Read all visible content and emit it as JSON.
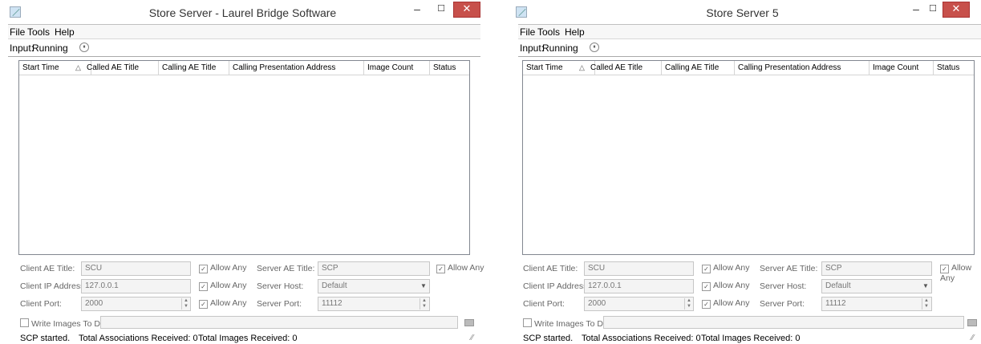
{
  "windows": [
    {
      "title": "Store Server - Laurel Bridge Software",
      "controls": {
        "minimize": "–",
        "maximize": "☐",
        "close": "✕"
      },
      "menu": [
        "File",
        "Tools",
        "Help"
      ],
      "input": {
        "label": "Input:",
        "state": "Running",
        "pause_glyph": "⏸"
      },
      "table": {
        "columns": [
          "Start Time",
          "Called AE Title",
          "Calling AE Title",
          "Calling Presentation Address",
          "Image Count",
          "Status"
        ],
        "sort_indicator": "△",
        "rows": []
      },
      "form": {
        "client_ae_label": "Client AE Title:",
        "client_ae_value": "SCU",
        "client_ip_label": "Client IP Address:",
        "client_ip_value": "127.0.0.1",
        "client_port_label": "Client Port:",
        "client_port_value": "2000",
        "allow_any": "Allow Any",
        "server_ae_label": "Server AE Title:",
        "server_ae_value": "SCP",
        "server_host_label": "Server Host:",
        "server_host_value": "Default",
        "server_port_label": "Server Port:",
        "server_port_value": "11112",
        "write_images_label": "Write Images To Disk"
      },
      "status": {
        "message": "SCP started.",
        "associations": "Total Associations Received: 0",
        "images": "Total Images Received: 0"
      }
    },
    {
      "title": "Store Server 5",
      "controls": {
        "minimize": "–",
        "maximize": "☐",
        "close": "✕"
      },
      "menu": [
        "File",
        "Tools",
        "Help"
      ],
      "input": {
        "label": "Input:",
        "state": "Running",
        "pause_glyph": "⏸"
      },
      "table": {
        "columns": [
          "Start Time",
          "Called AE Title",
          "Calling AE Title",
          "Calling Presentation Address",
          "Image Count",
          "Status"
        ],
        "sort_indicator": "△",
        "rows": []
      },
      "form": {
        "client_ae_label": "Client AE Title:",
        "client_ae_value": "SCU",
        "client_ip_label": "Client IP Address:",
        "client_ip_value": "127.0.0.1",
        "client_port_label": "Client Port:",
        "client_port_value": "2000",
        "allow_any": "Allow Any",
        "server_ae_label": "Server AE Title:",
        "server_ae_value": "SCP",
        "server_host_label": "Server Host:",
        "server_host_value": "Default",
        "server_port_label": "Server Port:",
        "server_port_value": "11112",
        "write_images_label": "Write Images To Disk"
      },
      "status": {
        "message": "SCP started.",
        "associations": "Total Associations Received: 0",
        "images": "Total Images Received: 0"
      }
    }
  ],
  "colors": {
    "close_button": "#c7504b",
    "table_border": "#828790",
    "field_bg": "#f4f4f4"
  }
}
